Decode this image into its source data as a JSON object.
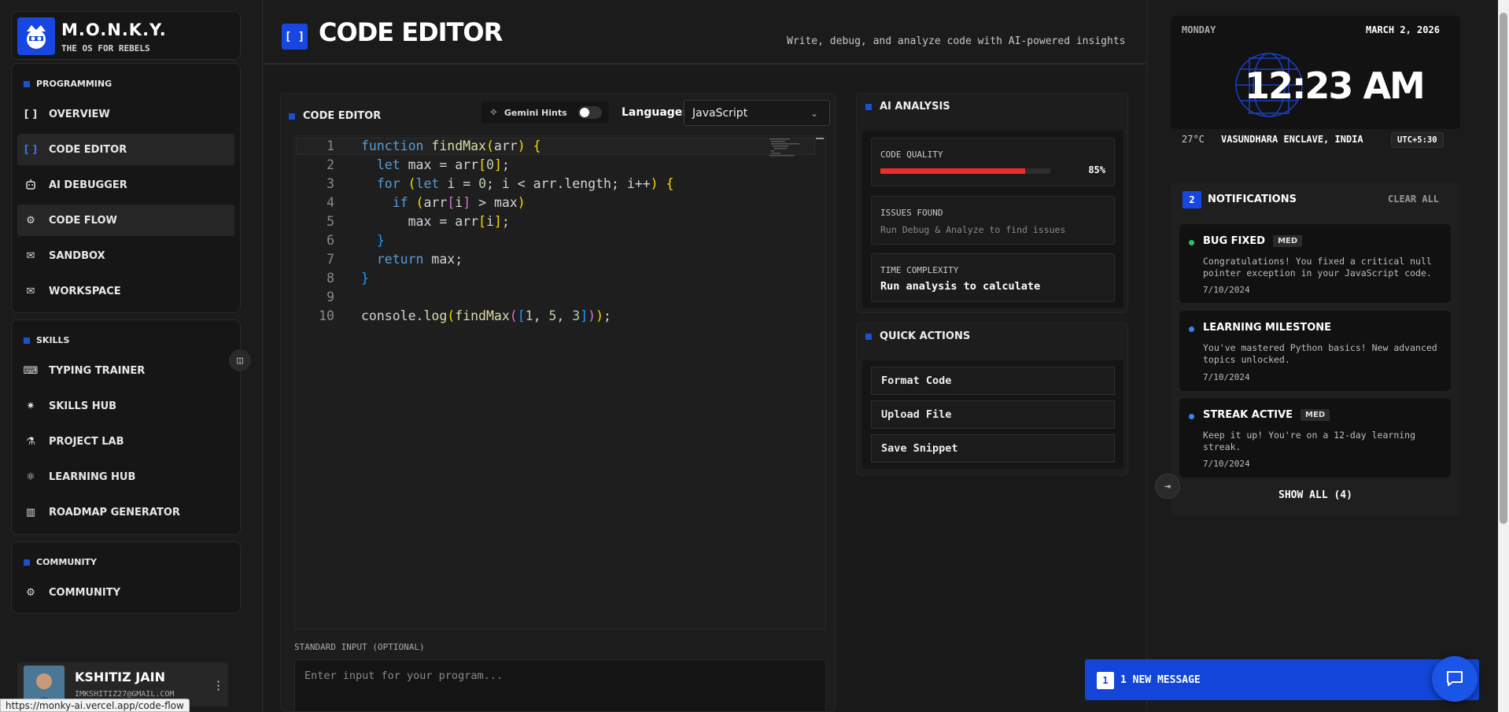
{
  "brand": {
    "title": "M.O.N.K.Y.",
    "subtitle": "THE OS FOR REBELS"
  },
  "sections": {
    "programming": "PROGRAMMING",
    "skills": "SKILLS",
    "community": "COMMUNITY"
  },
  "nav": {
    "programming": [
      {
        "label": "OVERVIEW",
        "icon": "brackets-icon"
      },
      {
        "label": "CODE EDITOR",
        "icon": "brackets-icon"
      },
      {
        "label": "AI DEBUGGER",
        "icon": "bot-icon"
      },
      {
        "label": "CODE FLOW",
        "icon": "gear-icon"
      },
      {
        "label": "SANDBOX",
        "icon": "mail-icon"
      },
      {
        "label": "WORKSPACE",
        "icon": "mail-icon"
      }
    ],
    "skills": [
      {
        "label": "TYPING TRAINER",
        "icon": "keyboard-icon"
      },
      {
        "label": "SKILLS HUB",
        "icon": "sparkle-icon"
      },
      {
        "label": "PROJECT LAB",
        "icon": "flask-icon"
      },
      {
        "label": "LEARNING HUB",
        "icon": "atom-icon"
      },
      {
        "label": "ROADMAP GENERATOR",
        "icon": "map-icon"
      }
    ],
    "community": [
      {
        "label": "COMMUNITY",
        "icon": "gear-icon"
      }
    ]
  },
  "user": {
    "name": "KSHITIZ JAIN",
    "email": "IMKSHITIZ27@GMAIL.COM"
  },
  "status_url": "https://monky-ai.vercel.app/code-flow",
  "header": {
    "title_icon": "[ ]",
    "title": "CODE EDITOR",
    "subtitle": "Write, debug, and analyze code with AI-powered insights"
  },
  "editor": {
    "label": "CODE EDITOR",
    "hints_label": "Gemini Hints",
    "hints_on": false,
    "language_label": "Language:",
    "language": "JavaScript",
    "line_numbers": [
      "1",
      "2",
      "3",
      "4",
      "5",
      "6",
      "7",
      "8",
      "9",
      "10"
    ],
    "code": [
      "function findMax(arr) {",
      "  let max = arr[0];",
      "  for (let i = 0; i < arr.length; i++) {",
      "    if (arr[i] > max)",
      "      max = arr[i];",
      "  }",
      "  return max;",
      "}",
      "",
      "console.log(findMax([1, 5, 3]));"
    ],
    "stdin_label": "STANDARD INPUT (OPTIONAL)",
    "stdin_placeholder": "Enter input for your program..."
  },
  "analysis": {
    "title": "AI ANALYSIS",
    "quality_label": "CODE QUALITY",
    "quality_value": "85%",
    "quality_fraction": 0.85,
    "issues_label": "ISSUES FOUND",
    "issues_text": "Run Debug & Analyze to find issues",
    "complexity_label": "TIME COMPLEXITY",
    "complexity_text": "Run analysis to calculate"
  },
  "quick_actions": {
    "title": "QUICK ACTIONS",
    "items": [
      "Format Code",
      "Upload File",
      "Save Snippet"
    ]
  },
  "clock": {
    "day": "MONDAY",
    "date": "MARCH 2, 2026",
    "time": "12:23 AM",
    "temp": "27°C",
    "location": "VASUNDHARA ENCLAVE, INDIA",
    "tz": "UTC+5:30"
  },
  "notifications": {
    "count": "2",
    "title": "NOTIFICATIONS",
    "clear": "CLEAR ALL",
    "items": [
      {
        "title": "BUG FIXED",
        "badge": "MED",
        "text": "Congratulations! You fixed a critical null pointer exception in your JavaScript code.",
        "date": "7/10/2024",
        "dot": "#22c55e"
      },
      {
        "title": "LEARNING MILESTONE",
        "badge": "",
        "text": "You've mastered Python basics! New advanced topics unlocked.",
        "date": "7/10/2024",
        "dot": "#3b82f6"
      },
      {
        "title": "STREAK ACTIVE",
        "badge": "MED",
        "text": "Keep it up! You're on a 12-day learning streak.",
        "date": "7/10/2024",
        "dot": "#3b82f6"
      }
    ],
    "show_all": "SHOW ALL (4)"
  },
  "message_bar": {
    "count": "1",
    "label": "1 NEW MESSAGE"
  },
  "colors": {
    "accent": "#1747e0",
    "quality_bar": "#ef2b2b"
  }
}
